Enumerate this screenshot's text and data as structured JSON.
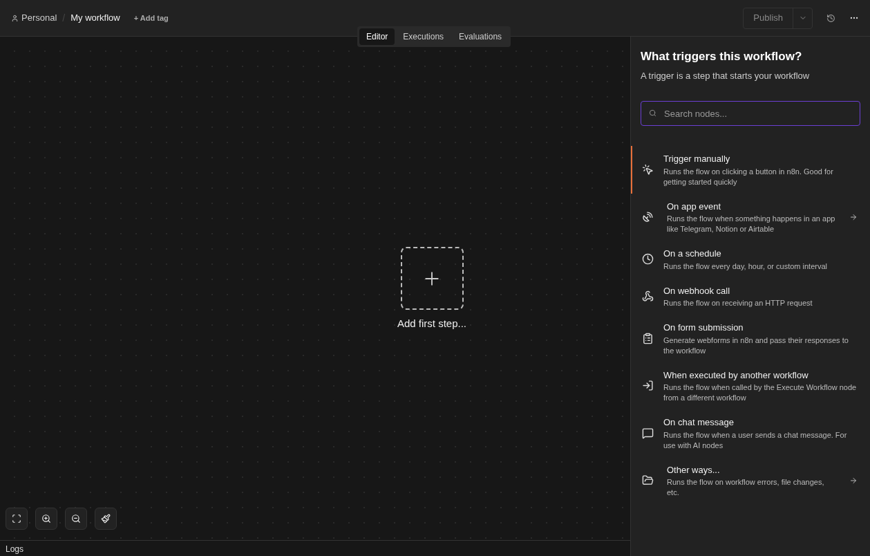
{
  "breadcrumb": {
    "project": "Personal",
    "separator": "/",
    "workflow": "My workflow",
    "add_tag": "+ Add tag"
  },
  "header_actions": {
    "publish": "Publish"
  },
  "tabs": [
    {
      "label": "Editor",
      "selected": true
    },
    {
      "label": "Executions",
      "selected": false
    },
    {
      "label": "Evaluations",
      "selected": false
    }
  ],
  "canvas": {
    "add_first_step": "Add first step..."
  },
  "panel": {
    "title": "What triggers this workflow?",
    "subtitle": "A trigger is a step that starts your workflow",
    "search": {
      "placeholder": "Search nodes..."
    },
    "items": [
      {
        "title": "Trigger manually",
        "description": "Runs the flow on clicking a button in n8n. Good for getting started quickly",
        "selected": true,
        "has_submenu": false
      },
      {
        "title": "On app event",
        "description": "Runs the flow when something happens in an app like Telegram, Notion or Airtable",
        "selected": false,
        "has_submenu": true
      },
      {
        "title": "On a schedule",
        "description": "Runs the flow every day, hour, or custom interval",
        "selected": false,
        "has_submenu": false
      },
      {
        "title": "On webhook call",
        "description": "Runs the flow on receiving an HTTP request",
        "selected": false,
        "has_submenu": false
      },
      {
        "title": "On form submission",
        "description": "Generate webforms in n8n and pass their responses to the workflow",
        "selected": false,
        "has_submenu": false
      },
      {
        "title": "When executed by another workflow",
        "description": "Runs the flow when called by the Execute Workflow node from a different workflow",
        "selected": false,
        "has_submenu": false
      },
      {
        "title": "On chat message",
        "description": "Runs the flow when a user sends a chat message. For use with AI nodes",
        "selected": false,
        "has_submenu": false
      },
      {
        "title": "Other ways...",
        "description": "Runs the flow on workflow errors, file changes, etc.",
        "selected": false,
        "has_submenu": true
      }
    ]
  },
  "logs": {
    "label": "Logs"
  }
}
